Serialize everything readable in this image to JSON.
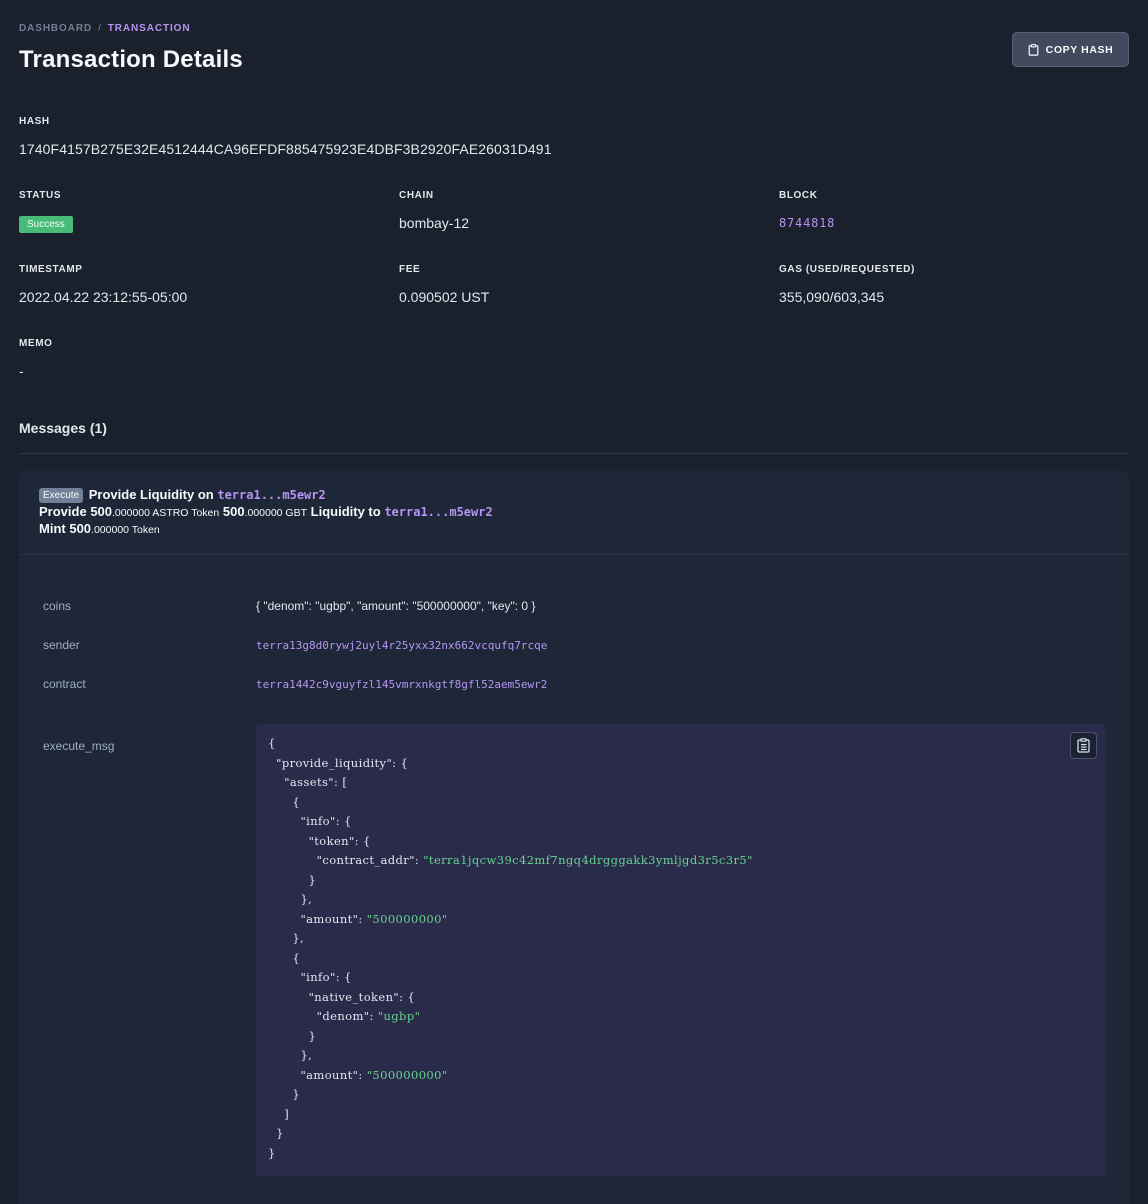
{
  "breadcrumb": {
    "root": "DASHBOARD",
    "separator": "/",
    "current": "TRANSACTION"
  },
  "page": {
    "title": "Transaction Details",
    "copy_hash_label": "COPY HASH"
  },
  "hash": {
    "label": "HASH",
    "value": "1740F4157B275E32E4512444CA96EFDF885475923E4DBF3B2920FAE26031D491"
  },
  "status": {
    "label": "STATUS",
    "value": "Success"
  },
  "chain": {
    "label": "CHAIN",
    "value": "bombay-12"
  },
  "block": {
    "label": "BLOCK",
    "value": "8744818"
  },
  "timestamp": {
    "label": "TIMESTAMP",
    "value": "2022.04.22 23:12:55-05:00"
  },
  "fee": {
    "label": "FEE",
    "value": "0.090502 UST"
  },
  "gas": {
    "label": "GAS (USED/REQUESTED)",
    "value": "355,090/603,345"
  },
  "memo": {
    "label": "MEMO",
    "value": "-"
  },
  "messages": {
    "title": "Messages (1)",
    "items": [
      {
        "type_badge": "Execute",
        "line1_text": "Provide Liquidity on",
        "line1_addr": "terra1...m5ewr2",
        "line2_prefix": "Provide",
        "line2_amount1_int": "500",
        "line2_amount1_dec": ".000000 ASTRO Token",
        "line2_amount2_int": "500",
        "line2_amount2_dec": ".000000 GBT",
        "line2_suffix": "Liquidity to",
        "line2_addr": "terra1...m5ewr2",
        "line3_prefix": "Mint",
        "line3_amount_int": "500",
        "line3_amount_dec": ".000000 Token",
        "fields": {
          "coins_key": "coins",
          "coins_value": "{ \"denom\": \"ugbp\", \"amount\": \"500000000\", \"key\": 0 }",
          "sender_key": "sender",
          "sender_value": "terra13g8d0rywj2uyl4r25yxx32nx662vcqufq7rcqe",
          "contract_key": "contract",
          "contract_value": "terra1442c9vguyfzl145vmrxnkgtf8gfl52aem5ewr2",
          "execute_msg_key": "execute_msg"
        },
        "execute_msg": {
          "provide_liquidity_key": "\"provide_liquidity\"",
          "assets_key": "\"assets\"",
          "info_key": "\"info\"",
          "token_key": "\"token\"",
          "contract_addr_key": "\"contract_addr\"",
          "contract_addr_value": "\"terra1jqcw39c42mf7ngq4drgggakk3ymljgd3r5c3r5\"",
          "amount_key": "\"amount\"",
          "amount_value_1": "\"500000000\"",
          "native_token_key": "\"native_token\"",
          "denom_key": "\"denom\"",
          "denom_value": "\"ugbp\"",
          "amount_value_2": "\"500000000\""
        }
      }
    ]
  },
  "icons": {
    "copy": "clipboard-icon",
    "code_copy": "clipboard-list-icon"
  },
  "colors": {
    "background": "#1a202c",
    "accent": "#b794f4",
    "success": "#48bb78",
    "code_bg": "#2a2a4a",
    "string": "#68d391"
  }
}
